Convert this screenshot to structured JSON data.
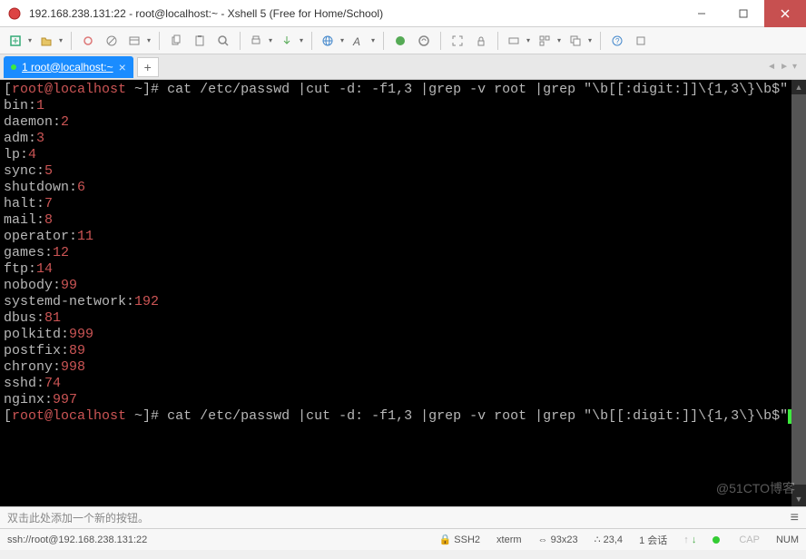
{
  "window": {
    "title": "192.168.238.131:22 - root@localhost:~ - Xshell 5 (Free for Home/School)"
  },
  "tab": {
    "label": "1 root@localhost:~"
  },
  "terminal": {
    "prompt1_user": "root@localhost",
    "prompt1_path": "~",
    "command1": "cat /etc/passwd |cut -d: -f1,3 |grep -v root |grep \"\\b[[:digit:]]\\{1,3\\}\\b$\"",
    "lines": [
      {
        "user": "bin",
        "id": "1"
      },
      {
        "user": "daemon",
        "id": "2"
      },
      {
        "user": "adm",
        "id": "3"
      },
      {
        "user": "lp",
        "id": "4"
      },
      {
        "user": "sync",
        "id": "5"
      },
      {
        "user": "shutdown",
        "id": "6"
      },
      {
        "user": "halt",
        "id": "7"
      },
      {
        "user": "mail",
        "id": "8"
      },
      {
        "user": "operator",
        "id": "11"
      },
      {
        "user": "games",
        "id": "12"
      },
      {
        "user": "ftp",
        "id": "14"
      },
      {
        "user": "nobody",
        "id": "99"
      },
      {
        "user": "systemd-network",
        "id": "192"
      },
      {
        "user": "dbus",
        "id": "81"
      },
      {
        "user": "polkitd",
        "id": "999"
      },
      {
        "user": "postfix",
        "id": "89"
      },
      {
        "user": "chrony",
        "id": "998"
      },
      {
        "user": "sshd",
        "id": "74"
      },
      {
        "user": "nginx",
        "id": "997"
      }
    ],
    "prompt2_user": "root@localhost",
    "prompt2_path": "~",
    "command2": "cat /etc/passwd |cut -d: -f1,3 |grep -v root |grep \"\\b[[:digit:]]\\{1,3\\}\\b$\""
  },
  "quickbar": {
    "hint": "双击此处添加一个新的按钮。"
  },
  "statusbar": {
    "connection": "ssh://root@192.168.238.131:22",
    "protocol": "SSH2",
    "term": "xterm",
    "size": "93x23",
    "cursor": "23,4",
    "sessions": "1 会话",
    "caps": "CAP",
    "num": "NUM"
  },
  "watermark": "@51CTO博客"
}
